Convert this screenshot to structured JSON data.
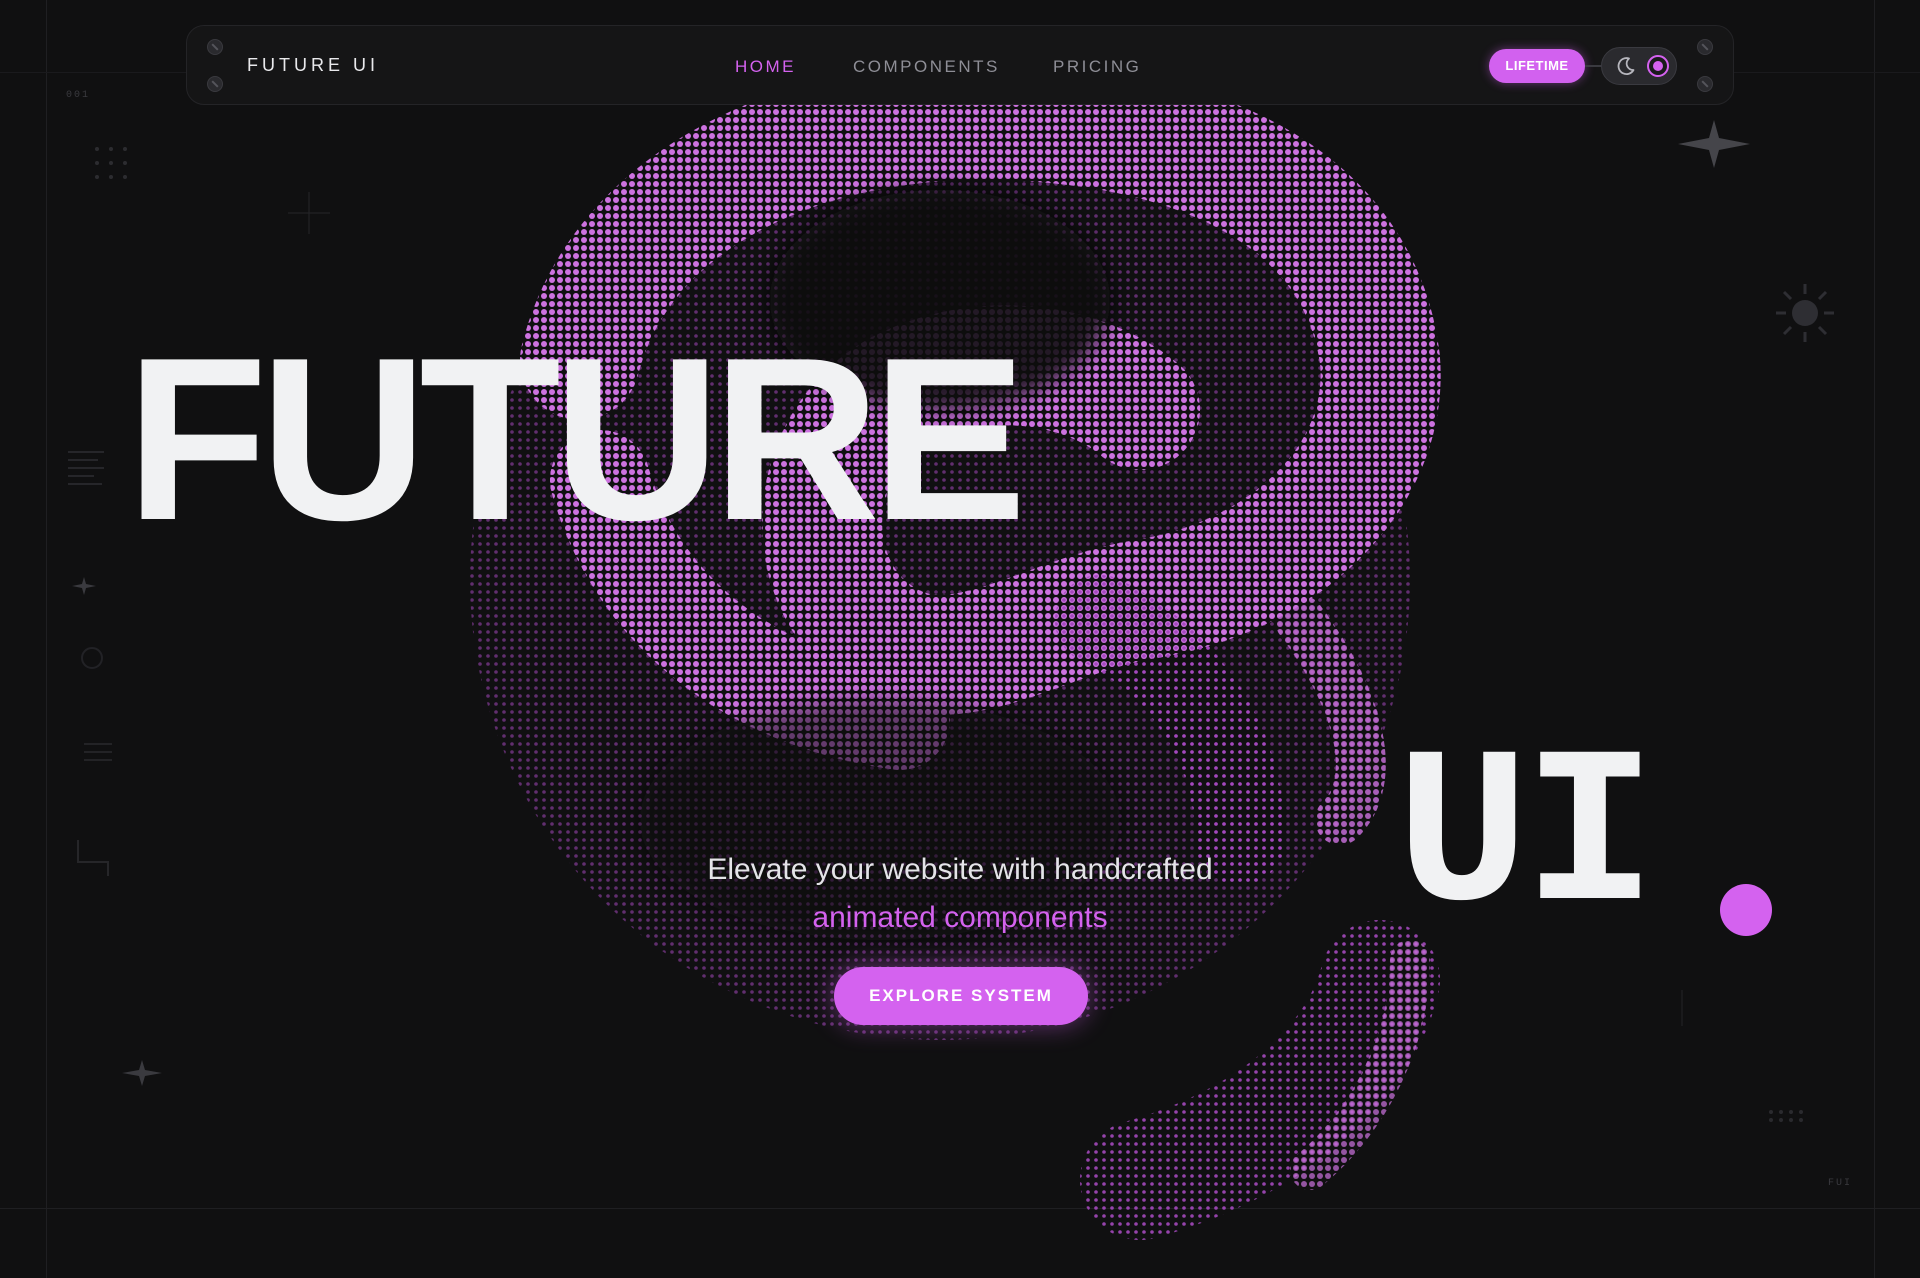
{
  "brand": {
    "name": "FUTURE UI",
    "accent": "#d462ef",
    "background": "#101011"
  },
  "nav": {
    "links": [
      {
        "label": "HOME",
        "active": true
      },
      {
        "label": "COMPONENTS",
        "active": false
      },
      {
        "label": "PRICING",
        "active": false
      }
    ],
    "badge": "LIFETIME",
    "theme_toggle": {
      "icons": [
        "moon-icon",
        "radio-dot-icon"
      ]
    }
  },
  "hero": {
    "title_left": "FUTURE",
    "title_right": "UI",
    "tagline_line1": "Elevate your website with handcrafted",
    "tagline_line2": "animated components",
    "cta": "EXPLORE SYSTEM"
  },
  "decor": {
    "corner_label_left": "001",
    "corner_label_right": "FUI"
  }
}
